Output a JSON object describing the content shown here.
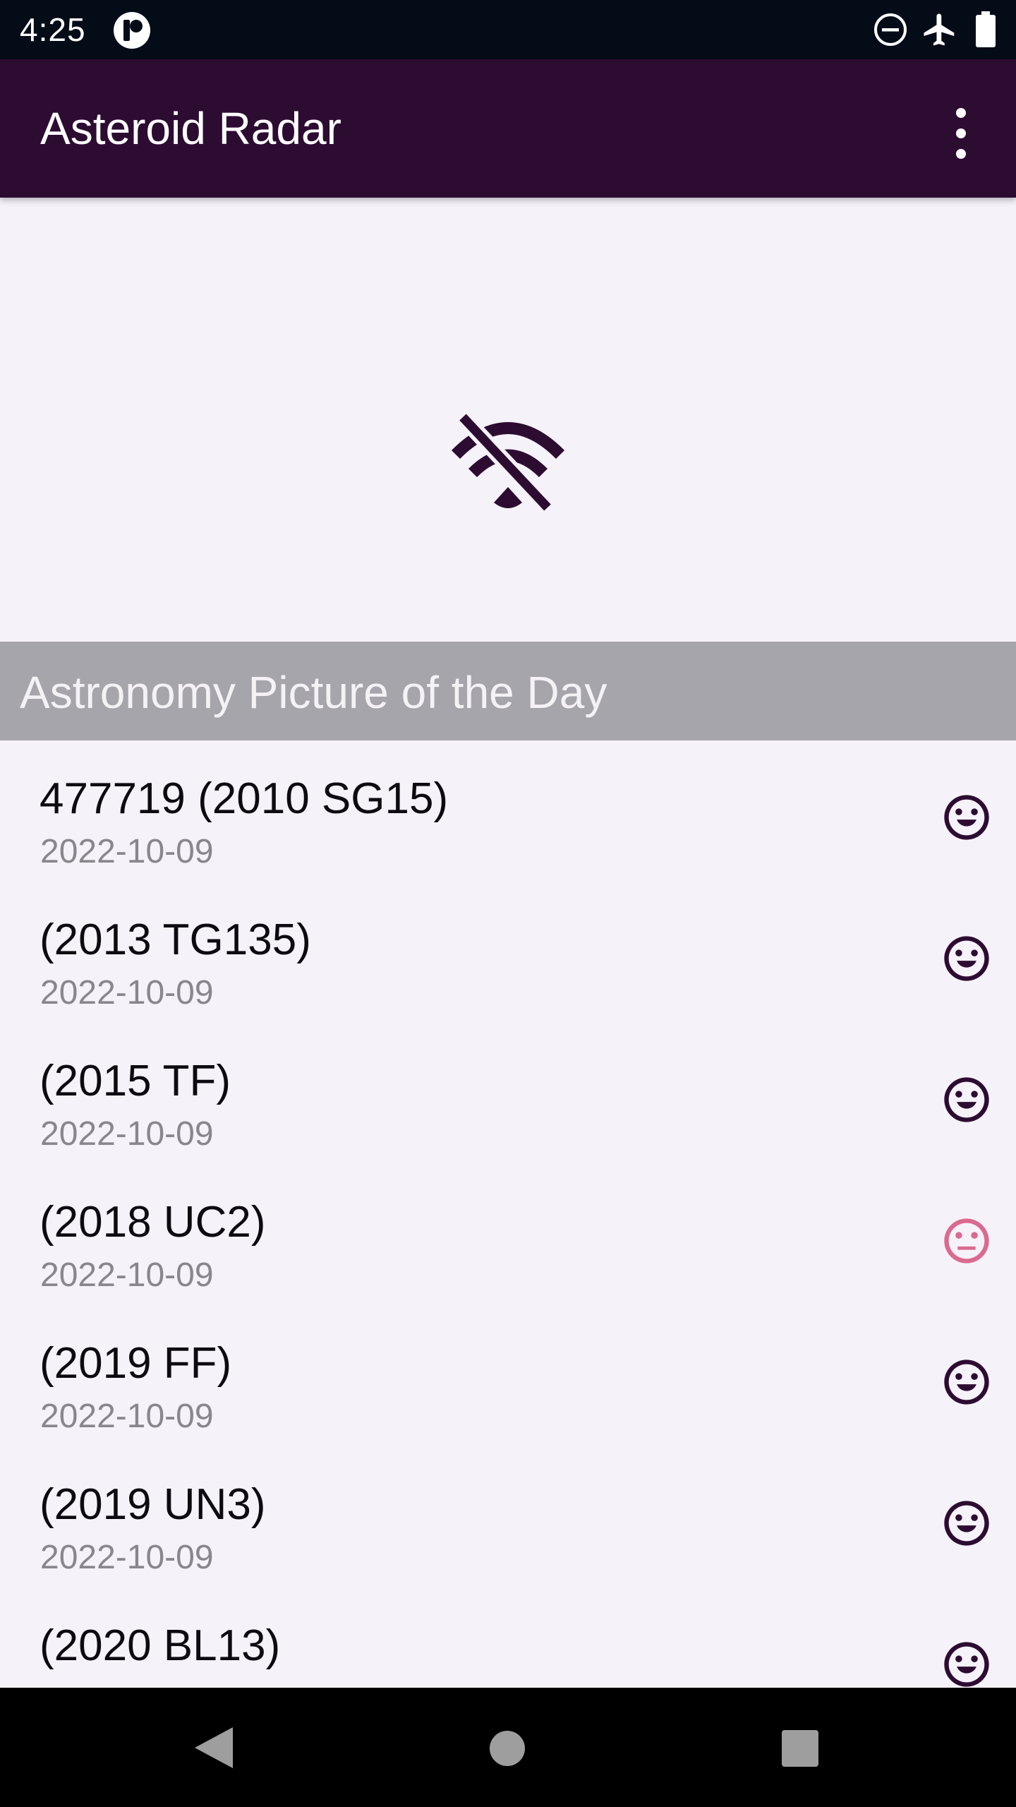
{
  "status_bar": {
    "time": "4:25",
    "icons": [
      "app-notification-icon",
      "do-not-disturb-icon",
      "airplane-mode-icon",
      "battery-full-icon"
    ]
  },
  "app_bar": {
    "title": "Asteroid Radar",
    "menu_icon": "more-vertical-icon"
  },
  "picture_of_day": {
    "placeholder_icon": "wifi-off-icon",
    "caption": "Astronomy Picture of the Day"
  },
  "asteroids": [
    {
      "name": "477719 (2010 SG15)",
      "date": "2022-10-09",
      "status_icon": "happy-face-icon",
      "hazardous": false
    },
    {
      "name": "(2013 TG135)",
      "date": "2022-10-09",
      "status_icon": "happy-face-icon",
      "hazardous": false
    },
    {
      "name": "(2015 TF)",
      "date": "2022-10-09",
      "status_icon": "happy-face-icon",
      "hazardous": false
    },
    {
      "name": "(2018 UC2)",
      "date": "2022-10-09",
      "status_icon": "neutral-face-icon",
      "hazardous": true
    },
    {
      "name": "(2019 FF)",
      "date": "2022-10-09",
      "status_icon": "happy-face-icon",
      "hazardous": false
    },
    {
      "name": "(2019 UN3)",
      "date": "2022-10-09",
      "status_icon": "happy-face-icon",
      "hazardous": false
    },
    {
      "name": "(2020 BL13)",
      "date": "",
      "status_icon": "happy-face-icon",
      "hazardous": false
    }
  ],
  "colors": {
    "status_bar": "#040c18",
    "app_bar": "#2d0c32",
    "background": "#f6f2fa",
    "caption_background": "#a6a5ab",
    "safe_icon": "#2d0c32",
    "hazard_icon": "#db6a8f",
    "nav_bar": "#000000"
  },
  "navigation": {
    "buttons": [
      "back-icon",
      "home-icon",
      "recents-icon"
    ]
  }
}
